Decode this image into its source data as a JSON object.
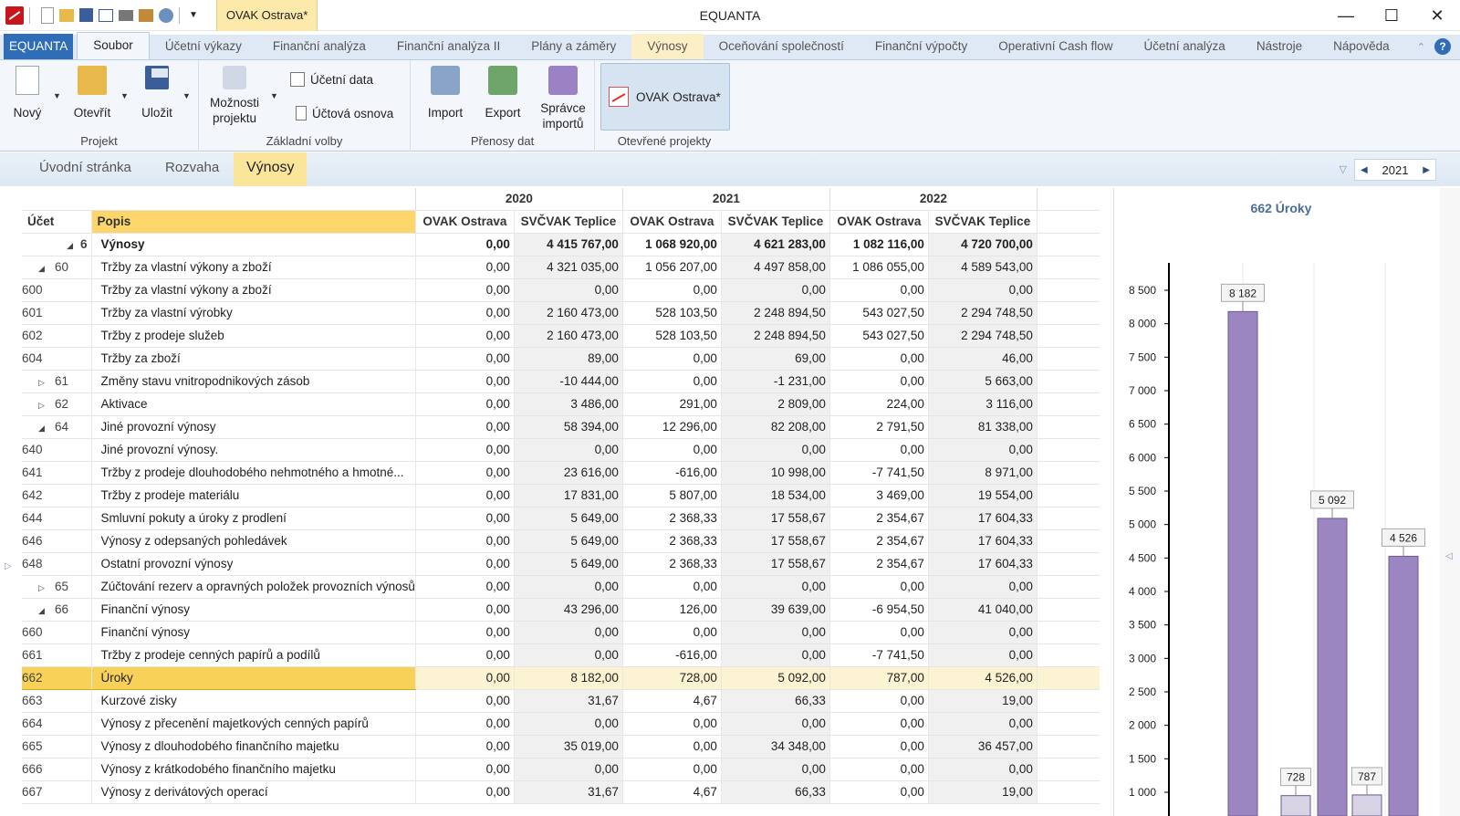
{
  "titlebar": {
    "app_title": "EQUANTA",
    "doc_tab": "OVAK Ostrava*",
    "qa_icons": [
      "new-icon",
      "open-icon",
      "save-icon",
      "report-icon",
      "print-icon",
      "import-icon",
      "sync-icon"
    ]
  },
  "ribbon_tabs": [
    "EQUANTA",
    "Soubor",
    "Účetní výkazy",
    "Finanční analýza",
    "Finanční analýza II",
    "Plány a záměry",
    "Výnosy",
    "Oceňování společností",
    "Finanční výpočty",
    "Operativní Cash flow",
    "Účetní analýza",
    "Nástroje",
    "Nápověda"
  ],
  "ribbon": {
    "projekt": {
      "label": "Projekt",
      "novy": "Nový",
      "otevrit": "Otevřít",
      "ulozit": "Uložit"
    },
    "zakladni": {
      "label": "Základní volby",
      "moznosti": "Možnosti projektu",
      "ucetni_data": "Účetní data",
      "uctova_osnova": "Účtová osnova"
    },
    "prenosy": {
      "label": "Přenosy dat",
      "import": "Import",
      "export": "Export",
      "spravce": "Správce importů"
    },
    "otevrene": {
      "label": "Otevřené projekty",
      "project": "OVAK Ostrava*"
    }
  },
  "sheet_tabs": [
    "Úvodní stránka",
    "Rozvaha",
    "Výnosy"
  ],
  "year_selector": "2021",
  "table": {
    "years": [
      "2020",
      "2021",
      "2022"
    ],
    "col_ucet": "Účet",
    "col_popis": "Popis",
    "companies": [
      "OVAK Ostrava",
      "SVČVAK Teplice"
    ],
    "rows": [
      {
        "acc": "6",
        "desc": "Výnosy",
        "level": 0,
        "exp": "open",
        "bold": true,
        "v": [
          "0,00",
          "4 415 767,00",
          "1 068 920,00",
          "4 621 283,00",
          "1 082 116,00",
          "4 720 700,00"
        ]
      },
      {
        "acc": "60",
        "desc": "Tržby za vlastní výkony a zboží",
        "level": 1,
        "exp": "open",
        "v": [
          "0,00",
          "4 321 035,00",
          "1 056 207,00",
          "4 497 858,00",
          "1 086 055,00",
          "4 589 543,00"
        ]
      },
      {
        "acc": "600",
        "desc": "Tržby za vlastní výkony a zboží",
        "level": 2,
        "v": [
          "0,00",
          "0,00",
          "0,00",
          "0,00",
          "0,00",
          "0,00"
        ]
      },
      {
        "acc": "601",
        "desc": "Tržby za vlastní výrobky",
        "level": 2,
        "v": [
          "0,00",
          "2 160 473,00",
          "528 103,50",
          "2 248 894,50",
          "543 027,50",
          "2 294 748,50"
        ]
      },
      {
        "acc": "602",
        "desc": "Tržby z prodeje služeb",
        "level": 2,
        "v": [
          "0,00",
          "2 160 473,00",
          "528 103,50",
          "2 248 894,50",
          "543 027,50",
          "2 294 748,50"
        ]
      },
      {
        "acc": "604",
        "desc": "Tržby za zboží",
        "level": 2,
        "v": [
          "0,00",
          "89,00",
          "0,00",
          "69,00",
          "0,00",
          "46,00"
        ]
      },
      {
        "acc": "61",
        "desc": "Změny stavu vnitropodnikových zásob",
        "level": 1,
        "exp": "closed",
        "v": [
          "0,00",
          "-10 444,00",
          "0,00",
          "-1 231,00",
          "0,00",
          "5 663,00"
        ]
      },
      {
        "acc": "62",
        "desc": "Aktivace",
        "level": 1,
        "exp": "closed",
        "v": [
          "0,00",
          "3 486,00",
          "291,00",
          "2 809,00",
          "224,00",
          "3 116,00"
        ]
      },
      {
        "acc": "64",
        "desc": "Jiné provozní výnosy",
        "level": 1,
        "exp": "open",
        "v": [
          "0,00",
          "58 394,00",
          "12 296,00",
          "82 208,00",
          "2 791,50",
          "81 338,00"
        ]
      },
      {
        "acc": "640",
        "desc": "Jiné provozní výnosy.",
        "level": 2,
        "v": [
          "0,00",
          "0,00",
          "0,00",
          "0,00",
          "0,00",
          "0,00"
        ]
      },
      {
        "acc": "641",
        "desc": "Tržby z prodeje dlouhodobého nehmotného a hmotné...",
        "level": 2,
        "v": [
          "0,00",
          "23 616,00",
          "-616,00",
          "10 998,00",
          "-7 741,50",
          "8 971,00"
        ]
      },
      {
        "acc": "642",
        "desc": "Tržby z prodeje materiálu",
        "level": 2,
        "v": [
          "0,00",
          "17 831,00",
          "5 807,00",
          "18 534,00",
          "3 469,00",
          "19 554,00"
        ]
      },
      {
        "acc": "644",
        "desc": "Smluvní pokuty a úroky z prodlení",
        "level": 2,
        "v": [
          "0,00",
          "5 649,00",
          "2 368,33",
          "17 558,67",
          "2 354,67",
          "17 604,33"
        ]
      },
      {
        "acc": "646",
        "desc": "Výnosy z odepsaných pohledávek",
        "level": 2,
        "v": [
          "0,00",
          "5 649,00",
          "2 368,33",
          "17 558,67",
          "2 354,67",
          "17 604,33"
        ]
      },
      {
        "acc": "648",
        "desc": "Ostatní provozní výnosy",
        "level": 2,
        "v": [
          "0,00",
          "5 649,00",
          "2 368,33",
          "17 558,67",
          "2 354,67",
          "17 604,33"
        ]
      },
      {
        "acc": "65",
        "desc": "Zúčtování rezerv a opravných položek provozních výnosů",
        "level": 1,
        "exp": "closed",
        "v": [
          "0,00",
          "0,00",
          "0,00",
          "0,00",
          "0,00",
          "0,00"
        ]
      },
      {
        "acc": "66",
        "desc": "Finanční výnosy",
        "level": 1,
        "exp": "open",
        "v": [
          "0,00",
          "43 296,00",
          "126,00",
          "39 639,00",
          "-6 954,50",
          "41 040,00"
        ]
      },
      {
        "acc": "660",
        "desc": "Finanční výnosy",
        "level": 2,
        "v": [
          "0,00",
          "0,00",
          "0,00",
          "0,00",
          "0,00",
          "0,00"
        ]
      },
      {
        "acc": "661",
        "desc": "Tržby z prodeje cenných papírů a podílů",
        "level": 2,
        "v": [
          "0,00",
          "0,00",
          "-616,00",
          "0,00",
          "-7 741,50",
          "0,00"
        ]
      },
      {
        "acc": "662",
        "desc": "Úroky",
        "level": 2,
        "selected": true,
        "v": [
          "0,00",
          "8 182,00",
          "728,00",
          "5 092,00",
          "787,00",
          "4 526,00"
        ]
      },
      {
        "acc": "663",
        "desc": "Kurzové zisky",
        "level": 2,
        "v": [
          "0,00",
          "31,67",
          "4,67",
          "66,33",
          "0,00",
          "19,00"
        ]
      },
      {
        "acc": "664",
        "desc": "Výnosy z přecenění majetkových cenných papírů",
        "level": 2,
        "v": [
          "0,00",
          "0,00",
          "0,00",
          "0,00",
          "0,00",
          "0,00"
        ]
      },
      {
        "acc": "665",
        "desc": "Výnosy z dlouhodobého finančního majetku",
        "level": 2,
        "v": [
          "0,00",
          "35 019,00",
          "0,00",
          "34 348,00",
          "0,00",
          "36 457,00"
        ]
      },
      {
        "acc": "666",
        "desc": "Výnosy z krátkodobého finančního majetku",
        "level": 2,
        "v": [
          "0,00",
          "0,00",
          "0,00",
          "0,00",
          "0,00",
          "0,00"
        ]
      },
      {
        "acc": "667",
        "desc": "Výnosy z derivátových operací",
        "level": 2,
        "v": [
          "0,00",
          "31,67",
          "4,67",
          "66,33",
          "0,00",
          "19,00"
        ]
      }
    ]
  },
  "chart_data": {
    "type": "bar",
    "title": "662 Úroky",
    "categories": [
      "2020",
      "2021",
      "2022"
    ],
    "series": [
      {
        "name": "OVAK Ostrava",
        "values": [
          null,
          728,
          787
        ],
        "color": "#d9d3e6"
      },
      {
        "name": "SVČVAK Teplice",
        "values": [
          8182,
          5092,
          4526
        ],
        "color": "#9b86c2"
      }
    ],
    "data_labels": [
      "8 182",
      "728",
      "5 092",
      "787",
      "4 526"
    ],
    "yticks": [
      "1 000",
      "1 500",
      "2 000",
      "2 500",
      "3 000",
      "3 500",
      "4 000",
      "4 500",
      "5 000",
      "5 500",
      "6 000",
      "6 500",
      "7 000",
      "7 500",
      "8 000",
      "8 500"
    ],
    "ylim": [
      1000,
      8700
    ]
  }
}
